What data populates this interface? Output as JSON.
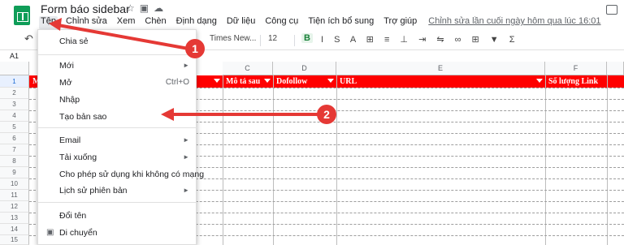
{
  "app": {
    "title": "Form báo sidebar",
    "icons": [
      "star-icon",
      "folder-icon",
      "cloud-icon"
    ]
  },
  "menubar": {
    "items": [
      "Tệp",
      "Chỉnh sửa",
      "Xem",
      "Chèn",
      "Định dạng",
      "Dữ liệu",
      "Công cụ",
      "Tiện ích bổ sung",
      "Trợ giúp"
    ],
    "last_edit": "Chỉnh sửa lần cuối ngày hôm qua lúc 16:01"
  },
  "toolbar": {
    "font_name": "Times New...",
    "font_size": "12",
    "bold_label": "B",
    "icons_text": "I S A ⊞ ≡ ⊥ ⇥ ⇋ ∞ ⊞ ▼ Σ"
  },
  "namebox": "A1",
  "grid": {
    "columns": [
      "C",
      "D",
      "E",
      "F"
    ],
    "rows": [
      "1",
      "2",
      "3",
      "4",
      "5",
      "6",
      "7",
      "8",
      "9",
      "10",
      "11",
      "12",
      "13",
      "14",
      "15"
    ],
    "header_cells": [
      "M",
      "Mô tả sau",
      "Dofollow",
      "URL",
      "Số lượng Link"
    ]
  },
  "menu": {
    "items": [
      {
        "label": "Chia sẻ",
        "shortcut": ""
      },
      {
        "label": "Mới",
        "shortcut": "►"
      },
      {
        "label": "Mở",
        "shortcut": "Ctrl+O"
      },
      {
        "label": "Nhập",
        "shortcut": ""
      },
      {
        "label": "Tạo bản sao",
        "shortcut": ""
      },
      {
        "label": "Email",
        "shortcut": "►"
      },
      {
        "label": "Tải xuống",
        "shortcut": "►"
      },
      {
        "label": "Cho phép sử dụng khi không có mạng",
        "shortcut": ""
      },
      {
        "label": "Lịch sử phiên bản",
        "shortcut": "►"
      },
      {
        "label": "Đổi tên",
        "shortcut": ""
      },
      {
        "label": "Di chuyển",
        "shortcut": ""
      }
    ]
  },
  "annotations": {
    "badge_1": "1",
    "badge_2": "2",
    "color": "#e53935"
  },
  "colors": {
    "header_row": "#ff0000",
    "sheets_green": "#0f9d58"
  }
}
